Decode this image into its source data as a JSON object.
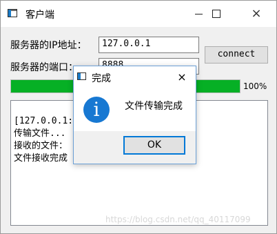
{
  "window": {
    "title": "客户端",
    "icon": "app-window-icon",
    "controls": {
      "minimize": "minimize-icon",
      "maximize": "maximize-icon",
      "close": "×"
    }
  },
  "form": {
    "ip_label": "服务器的IP地址：",
    "ip_value": "127.0.0.1",
    "port_label": "服务器的端口：",
    "port_value": "8888",
    "connect_label": "connect"
  },
  "progress": {
    "value": 1.0,
    "text": "100%",
    "color": "#06b025"
  },
  "log": {
    "lines": [
      "[127.0.0.1:          ，等待服务器",
      "传输文件...",
      "接收的文件：          97127 KB]",
      "文件接收完成"
    ]
  },
  "dialog": {
    "title": "完成",
    "close": "×",
    "message": "文件传输完成",
    "icon": "info-icon",
    "icon_glyph": "i",
    "ok_label": "OK"
  },
  "watermark": "https://blog.csdn.net/qq_40117099"
}
